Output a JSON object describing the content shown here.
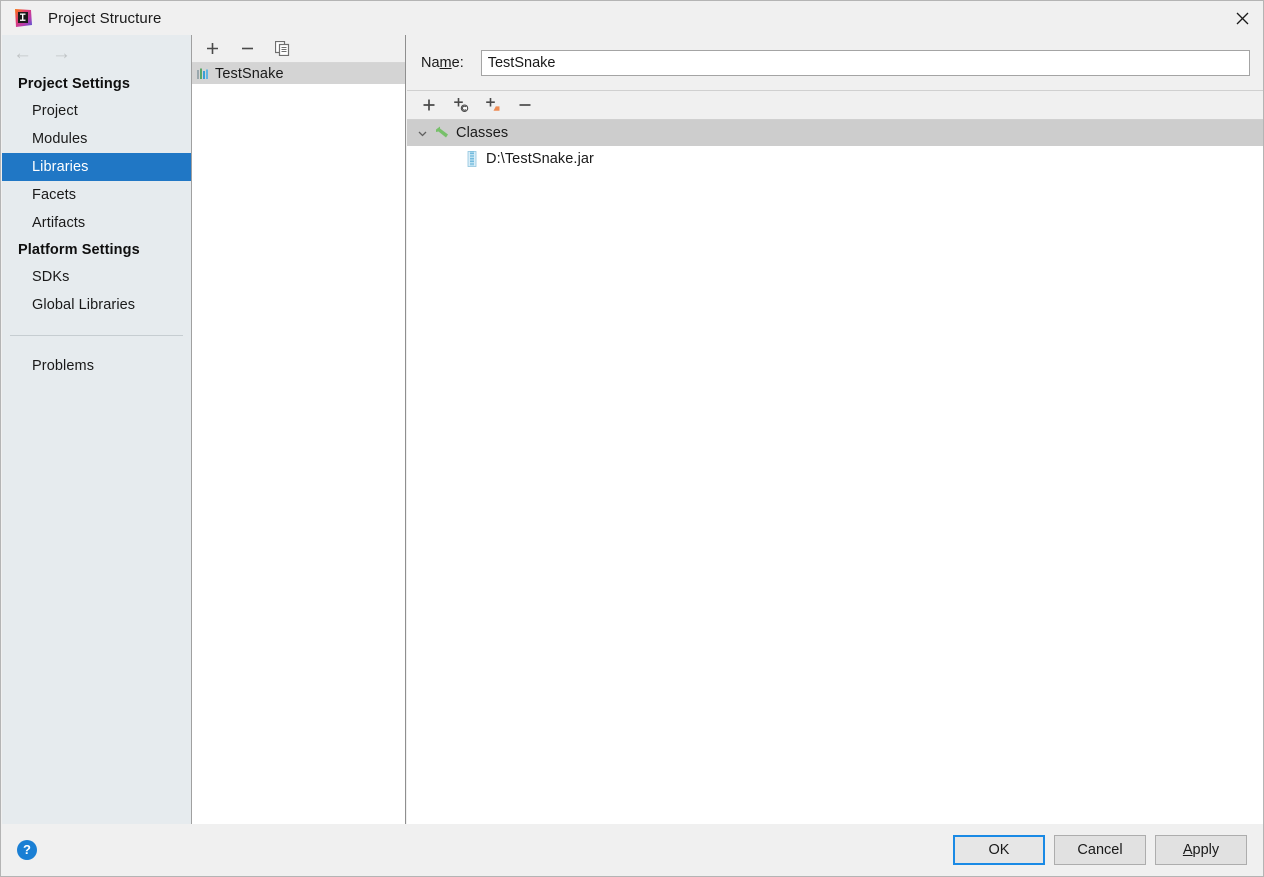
{
  "window": {
    "title": "Project Structure",
    "app_icon": "intellij-idea-logo",
    "close_label": "✕"
  },
  "sidebar": {
    "nav_back": "←",
    "nav_forward": "→",
    "groups": [
      {
        "title": "Project Settings",
        "items": [
          {
            "label": "Project",
            "selected": false
          },
          {
            "label": "Modules",
            "selected": false
          },
          {
            "label": "Libraries",
            "selected": true
          },
          {
            "label": "Facets",
            "selected": false
          },
          {
            "label": "Artifacts",
            "selected": false
          }
        ]
      },
      {
        "title": "Platform Settings",
        "items": [
          {
            "label": "SDKs",
            "selected": false
          },
          {
            "label": "Global Libraries",
            "selected": false
          }
        ]
      }
    ],
    "extra_items": [
      {
        "label": "Problems",
        "selected": false
      }
    ],
    "selection_color": "#2077c5"
  },
  "library_panel": {
    "toolbar": [
      {
        "name": "add-library-button",
        "glyph": "+"
      },
      {
        "name": "remove-library-button",
        "glyph": "−"
      },
      {
        "name": "copy-library-button",
        "glyph": "copy-icon"
      }
    ],
    "items": [
      {
        "label": "TestSnake",
        "icon": "library-icon",
        "selected": true
      }
    ]
  },
  "details": {
    "name_label_pre": "Na",
    "name_label_mnemonic": "m",
    "name_label_post": "e:",
    "name_value": "TestSnake",
    "name_placeholder": "",
    "toolbar": [
      {
        "name": "add-root-button",
        "glyph": "+"
      },
      {
        "name": "add-classes-root-button",
        "glyph": "+⊙"
      },
      {
        "name": "add-sources-root-button",
        "glyph": "+■"
      },
      {
        "name": "remove-root-button",
        "glyph": "−"
      }
    ],
    "tree": [
      {
        "label": "Classes",
        "icon": "classes-root-icon",
        "level": 0,
        "expanded": true,
        "selected": true,
        "toggle": "∨"
      },
      {
        "label": "D:\\TestSnake.jar",
        "icon": "jar-file-icon",
        "level": 1,
        "expanded": false,
        "selected": false,
        "toggle": ""
      }
    ]
  },
  "footer": {
    "help_glyph": "?",
    "buttons": [
      {
        "name": "ok-button",
        "label": "OK",
        "default": true,
        "mnemonic": ""
      },
      {
        "name": "cancel-button",
        "label": "Cancel",
        "default": false,
        "mnemonic": ""
      },
      {
        "name": "apply-button",
        "label": "pply",
        "default": false,
        "mnemonic": "A"
      }
    ]
  }
}
